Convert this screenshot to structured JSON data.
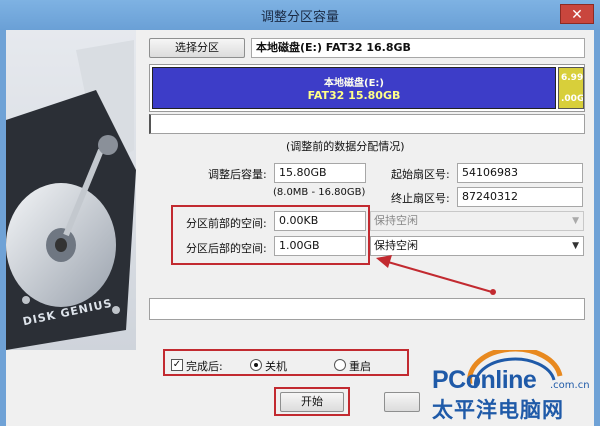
{
  "window": {
    "title": "调整分区容量",
    "close_glyph": "✕"
  },
  "select_partition": {
    "button_label": "选择分区",
    "partition_info": "本地磁盘(E:) FAT32 16.8GB"
  },
  "disk_bar": {
    "partition_label": "本地磁盘(E:)",
    "partition_size": "FAT32 15.80GB",
    "free_label_top": "6.99",
    "free_label_bottom": ".00G"
  },
  "section_title": "(调整前的数据分配情况)",
  "fields": {
    "new_capacity_label": "调整后容量:",
    "new_capacity_value": "15.80GB",
    "capacity_range": "(8.0MB - 16.80GB)",
    "start_sector_label": "起始扇区号:",
    "start_sector_value": "54106983",
    "end_sector_label": "终止扇区号:",
    "end_sector_value": "87240312",
    "space_before_label": "分区前部的空间:",
    "space_before_value": "0.00KB",
    "space_after_label": "分区后部的空间:",
    "space_after_value": "1.00GB",
    "before_mode": "保持空闲",
    "after_mode": "保持空闲"
  },
  "completion": {
    "checkbox_label": "完成后:",
    "checkbox_mark": "✓",
    "option_shutdown": "关机",
    "option_restart": "重启"
  },
  "start_button": "开始",
  "watermark": {
    "brand": "PConline",
    "domain": ".com.cn",
    "chinese": "太平洋电脑网"
  },
  "art_text": "DISK GENIUS",
  "colors": {
    "partition_fill": "#3d3dc8",
    "free_fill": "#d8cf3a",
    "annotation_red": "#c22a30",
    "titlebar": "#6fa2d6",
    "watermark_blue": "#1f5aa8",
    "watermark_orange": "#e8891f"
  }
}
